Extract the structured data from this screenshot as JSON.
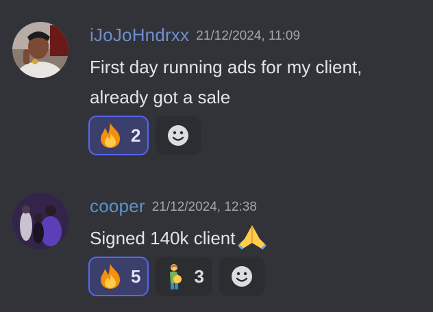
{
  "messages": [
    {
      "username": "iJoJoHndrxx",
      "timestamp": "21/12/2024, 11:09",
      "text": "First day running ads for my client,",
      "text_line2": "already got a sale",
      "reactions": [
        {
          "emoji": "fire-emoji",
          "count": "2",
          "selected": true
        }
      ]
    },
    {
      "username": "cooper",
      "timestamp": "21/12/2024, 12:38",
      "text": "Signed 140k client",
      "inline_emoji": "folded-hands-emoji",
      "reactions": [
        {
          "emoji": "fire-emoji",
          "count": "5",
          "selected": true
        },
        {
          "emoji": "pregnant-man-emoji",
          "count": "3",
          "selected": false
        }
      ]
    }
  ],
  "colors": {
    "background": "#313338",
    "reaction_selected_border": "#5865f2",
    "reaction_selected_bg": "#3b3f6b",
    "reaction_bg": "#2b2d31"
  },
  "icons": {
    "add_reaction": "smiley-add-reaction-icon"
  }
}
